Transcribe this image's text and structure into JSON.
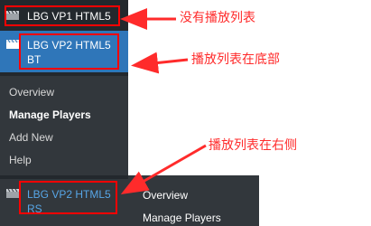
{
  "sidebar": {
    "items": [
      {
        "label": "LBG VP1 HTML5",
        "icon": "clapperboard-icon"
      },
      {
        "label": "LBG VP2 HTML5 BT",
        "icon": "clapperboard-icon",
        "state": "active"
      },
      {
        "label": "LBG VP2 HTML5 RS",
        "icon": "clapperboard-icon",
        "state": "hover"
      }
    ],
    "submenu": [
      "Overview",
      "Manage Players",
      "Add New",
      "Help"
    ]
  },
  "flyout": {
    "items": [
      "Overview",
      "Manage Players"
    ]
  },
  "annotations": [
    "没有播放列表",
    "播放列表在底部",
    "播放列表在右侧"
  ],
  "colors": {
    "sidebar_bg": "#23282d",
    "submenu_bg": "#32373c",
    "active_bg": "#2f76b9",
    "hover_text": "#57a6e7",
    "annotation_red": "#ff2b2b"
  }
}
